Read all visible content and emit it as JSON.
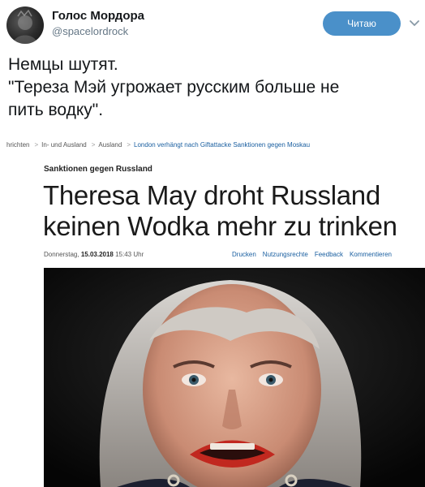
{
  "tweet": {
    "author": {
      "display_name": "Голос Мордора",
      "handle": "@spacelordrock"
    },
    "follow_button_label": "Читаю",
    "text_lines": [
      "Немцы шутят.",
      "\"Тереза Мэй угрожает русским больше не",
      "пить водку\"."
    ]
  },
  "media": {
    "breadcrumb": [
      "hrichten",
      "In- und Ausland",
      "Ausland",
      "London verhängt nach Giftattacke Sanktionen gegen Moskau"
    ],
    "kicker": "Sanktionen gegen Russland",
    "headline_lines": [
      "Theresa May droht Russland",
      "keinen Wodka mehr zu trinken"
    ],
    "date_prefix": "Donnerstag,",
    "date": "15.03.2018",
    "time": "15:43 Uhr",
    "actions": [
      "Drucken",
      "Nutzungsrechte",
      "Feedback",
      "Kommentieren"
    ]
  },
  "colors": {
    "follow_button": "#4a90c9",
    "link": "#1a5fa0",
    "handle": "#657786"
  },
  "icons": [
    "chevron-down-icon"
  ]
}
